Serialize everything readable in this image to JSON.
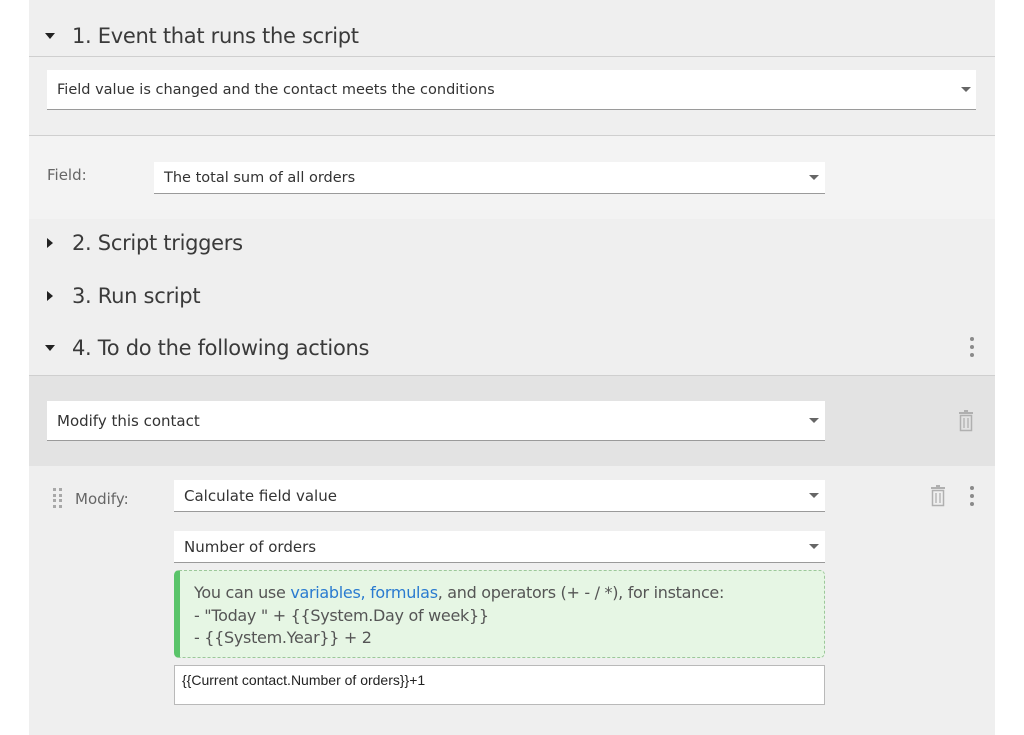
{
  "sections": {
    "s1": {
      "title": "1. Event that runs the script",
      "expanded": true
    },
    "s2": {
      "title": "2. Script triggers",
      "expanded": false
    },
    "s3": {
      "title": "3. Run script",
      "expanded": false
    },
    "s4": {
      "title": "4. To do the following actions",
      "expanded": true
    }
  },
  "event": {
    "selected": "Field value is changed and the contact meets the conditions"
  },
  "field": {
    "label": "Field:",
    "selected": "The total sum of all orders"
  },
  "action": {
    "selected": "Modify this contact"
  },
  "modify": {
    "label": "Modify:",
    "mode": "Calculate field value",
    "target_field": "Number of orders",
    "hint": {
      "prefix": "You can use ",
      "link_variables": "variables,",
      "link_formulas": "formulas",
      "suffix": ", and operators (+ - / *), for instance:",
      "example1": "- \"Today \" + {{System.Day of week}}",
      "example2": "- {{System.Year}} + 2"
    },
    "formula": "{{Current contact.Number of orders}}+1"
  },
  "colors": {
    "panel_bg": "#efefef",
    "hint_bg": "#e6f6e4",
    "hint_accent": "#5ac46a",
    "link": "#2a7bd0"
  },
  "icons": {
    "collapse": "caret-down-icon",
    "expand": "caret-right-icon",
    "menu": "kebab-menu-icon",
    "delete": "trash-icon",
    "drag": "drag-handle-icon"
  }
}
